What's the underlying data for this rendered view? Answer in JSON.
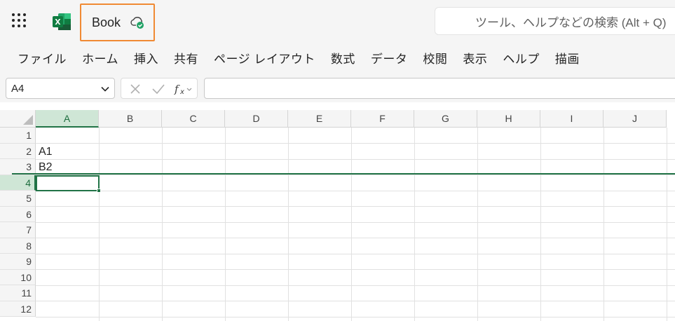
{
  "titlebar": {
    "app_launcher_icon": "waffle-icon",
    "app_icon": "excel-logo-icon",
    "doc_name": "Book",
    "save_status_icon": "cloud-check-icon",
    "search_placeholder": "ツール、ヘルプなどの検索 (Alt + Q)"
  },
  "ribbon": {
    "tabs": [
      {
        "label": "ファイル"
      },
      {
        "label": "ホーム"
      },
      {
        "label": "挿入"
      },
      {
        "label": "共有"
      },
      {
        "label": "ページ レイアウト"
      },
      {
        "label": "数式"
      },
      {
        "label": "データ"
      },
      {
        "label": "校閲"
      },
      {
        "label": "表示"
      },
      {
        "label": "ヘルプ"
      },
      {
        "label": "描画"
      }
    ]
  },
  "formula_bar": {
    "name_box": "A4",
    "cancel_icon": "cancel-x-icon",
    "enter_icon": "checkmark-icon",
    "function_icon": "function-fx-icon",
    "formula_value": ""
  },
  "sheet": {
    "columns": [
      "A",
      "B",
      "C",
      "D",
      "E",
      "F",
      "G",
      "H",
      "I",
      "J"
    ],
    "active_column": "A",
    "rows": [
      "1",
      "2",
      "3",
      "4",
      "5",
      "6",
      "7",
      "8",
      "9",
      "10",
      "11",
      "12"
    ],
    "active_row": "4",
    "cells": {
      "A2": "A1",
      "A3": "B2"
    },
    "selected_cell": "A4",
    "colors": {
      "accent": "#217346",
      "header_highlight": "#cfe6d6",
      "focus_outline": "#f08a34"
    }
  }
}
